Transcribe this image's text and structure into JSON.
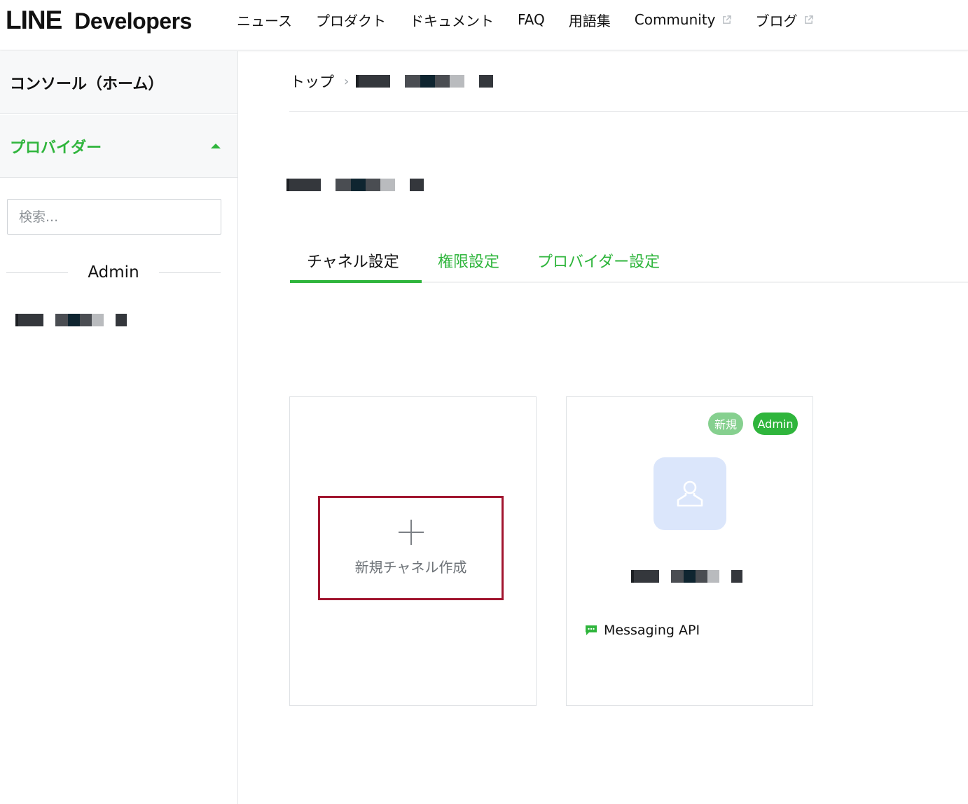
{
  "header": {
    "logo_line": "LINE",
    "logo_developers": "Developers",
    "nav": [
      {
        "label": "ニュース"
      },
      {
        "label": "プロダクト"
      },
      {
        "label": "ドキュメント"
      },
      {
        "label": "FAQ"
      },
      {
        "label": "用語集"
      },
      {
        "label": "Community",
        "icon": "external-link-icon"
      },
      {
        "label": "ブログ",
        "icon": "external-link-icon"
      }
    ]
  },
  "sidebar": {
    "console_label": "コンソール（ホーム）",
    "provider_label": "プロバイダー",
    "search_placeholder": "検索...",
    "admin_heading": "Admin"
  },
  "breadcrumb": {
    "top_label": "トップ",
    "separator": "›"
  },
  "tabs": [
    {
      "label": "チャネル設定",
      "active": true
    },
    {
      "label": "権限設定",
      "active": false
    },
    {
      "label": "プロバイダー設定",
      "active": false
    }
  ],
  "create_card": {
    "label": "新規チャネル作成"
  },
  "channel_card": {
    "badge_new": "新規",
    "badge_admin": "Admin",
    "avatar_icon": "user-icon",
    "type_label": "Messaging API",
    "type_icon": "chat-bubble-icon"
  },
  "colors": {
    "accent_green": "#2fb53c",
    "badge_new_green": "#86d08f",
    "highlight_border": "#a1152f",
    "avatar_bg": "#dbe6fb"
  }
}
